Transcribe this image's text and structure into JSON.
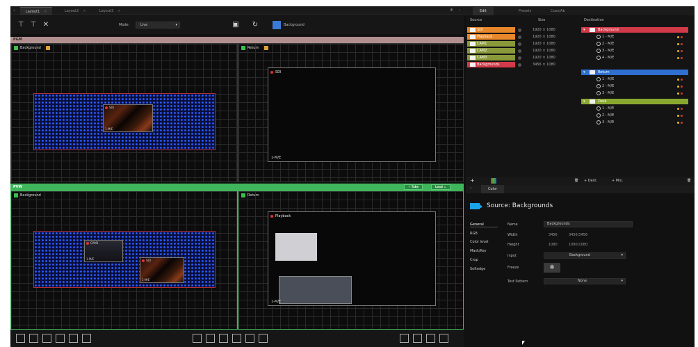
{
  "tabs": [
    {
      "label": "Layout1",
      "active": true
    },
    {
      "label": "Layout2",
      "active": false
    },
    {
      "label": "Layout3",
      "active": false
    }
  ],
  "toolbar": {
    "mode_label": "Mode:",
    "mode_value": "Live",
    "background_label": "Background",
    "background_color": "#3a7bd5"
  },
  "pgm": {
    "label": "PGM",
    "screen1": {
      "name": "Background",
      "layer_label": "SDI",
      "layer_foot": "1-M/E"
    },
    "screen2": {
      "name": "Return",
      "output_label": "SDI",
      "output_foot": "1-M/E"
    }
  },
  "pvw": {
    "label": "PVW",
    "take_label": "Take",
    "load_label": "Load",
    "screen1": {
      "name": "Background",
      "layer1_label": "CAM1",
      "layer1_foot": "1-M/E",
      "layer2_label": "SDI",
      "layer2_foot": "1-M/E"
    },
    "screen2": {
      "name": "Return",
      "output_label": "Playback",
      "output_foot": "1-M/E"
    }
  },
  "right_tabs": [
    {
      "label": "Edit",
      "active": true
    },
    {
      "label": "Presets",
      "active": false
    },
    {
      "label": "Cues/Ab",
      "active": false
    }
  ],
  "sources": {
    "col_source": "Source",
    "col_size": "Size",
    "col_destination": "Destination",
    "items": [
      {
        "name": "SDI",
        "size": "1920 × 1080",
        "color": "#e8882b"
      },
      {
        "name": "Playback",
        "size": "1920 × 1080",
        "color": "#e8882b"
      },
      {
        "name": "CAM1",
        "size": "1920 × 1080",
        "color": "#8a9a3a"
      },
      {
        "name": "CAM2",
        "size": "1920 × 1080",
        "color": "#8a9a3a"
      },
      {
        "name": "CAM3",
        "size": "1920 × 1080",
        "color": "#8a9a3a"
      },
      {
        "name": "Backgrounds",
        "size": "3456 × 1080",
        "color": "#d23a4a"
      }
    ]
  },
  "destinations": [
    {
      "name": "Background",
      "color": "#d23a4a",
      "items": [
        "1 - M/E",
        "2 - M/E",
        "3 - M/E",
        "4 - M/E"
      ]
    },
    {
      "name": "Return",
      "color": "#2f6fd0",
      "items": [
        "1 - M/E",
        "2 - M/E",
        "3 - M/E"
      ]
    },
    {
      "name": "Desk",
      "color": "#8aa830",
      "items": [
        "1 - M/E",
        "2 - M/E",
        "3 - M/E"
      ]
    }
  ],
  "panel_footer": {
    "dest_label": "Dest.",
    "mix_label": "Mix."
  },
  "color_tab": "Color",
  "source_panel": {
    "title": "Source: Backgrounds",
    "categories": [
      "General",
      "RGB",
      "Color level",
      "Mask/Key",
      "Crop",
      "Softedge"
    ],
    "name_label": "Name",
    "name_value": "Backgrounds",
    "width_label": "Width",
    "width_value": "3456",
    "width_extra": "3456/3456",
    "height_label": "Height",
    "height_value": "1080",
    "height_extra": "1080/1080",
    "input_label": "Input",
    "input_value": "Background",
    "freeze_label": "Freeze",
    "test_pattern_label": "Test Pattern",
    "test_pattern_value": "None"
  }
}
